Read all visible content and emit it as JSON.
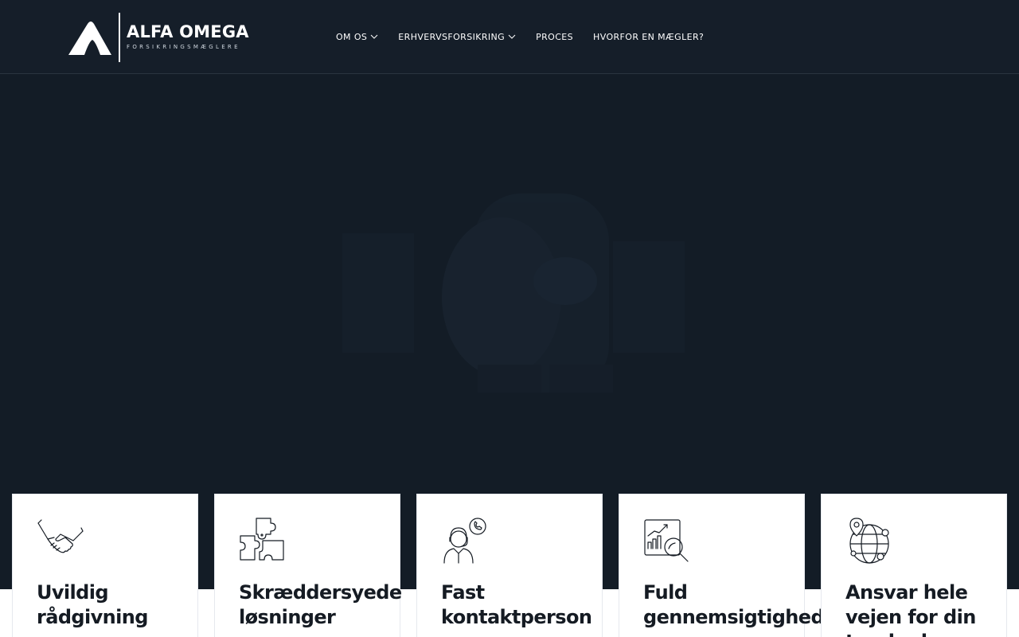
{
  "header": {
    "logo": {
      "title": "ALFA OMEGA",
      "subtitle": "FORSIKRINGSMÆGLERE"
    },
    "nav": [
      {
        "label": "OM OS",
        "has_dropdown": true
      },
      {
        "label": "ERHVERVSFORSIKRING",
        "has_dropdown": true
      },
      {
        "label": "PROCES",
        "has_dropdown": false
      },
      {
        "label": "HVORFOR EN MÆGLER?",
        "has_dropdown": false
      }
    ]
  },
  "colors": {
    "header_bg": "#151e29",
    "hero_bg": "#131c26",
    "card_bg": "#ffffff",
    "card_text": "#151b23",
    "nav_text": "#ffffff"
  },
  "cards": [
    {
      "icon": "handshake-icon",
      "title": "Uvildig rådgivning"
    },
    {
      "icon": "puzzle-icon",
      "title": "Skræddersyede løsninger"
    },
    {
      "icon": "support-agent-icon",
      "title": "Fast kontaktperson"
    },
    {
      "icon": "chart-magnifier-icon",
      "title": "Fuld gennemsigtighed"
    },
    {
      "icon": "globe-location-icon",
      "title": "Ansvar hele vejen for din tryghed"
    }
  ]
}
